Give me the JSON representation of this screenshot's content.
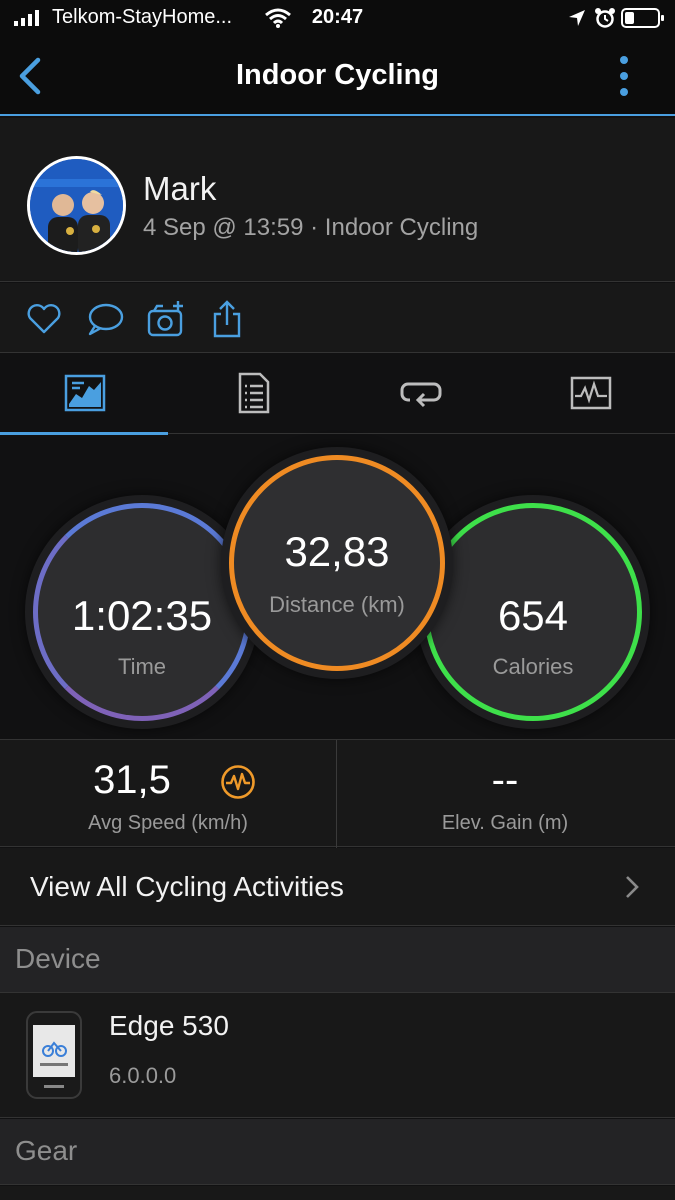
{
  "status_bar": {
    "carrier": "Telkom-StayHome...",
    "time": "20:47",
    "icons": [
      "signal-icon",
      "wifi-icon",
      "location-icon",
      "alarm-icon",
      "battery-icon"
    ]
  },
  "navbar": {
    "title": "Indoor Cycling",
    "back_icon": "chevron-left-icon",
    "more_icon": "more-vertical-icon"
  },
  "profile": {
    "name": "Mark",
    "meta": "4 Sep @ 13:59 · Indoor Cycling"
  },
  "actions": [
    "heart-icon",
    "comment-icon",
    "add-photo-icon",
    "share-icon"
  ],
  "tabs": [
    {
      "icon": "overview-icon",
      "active": true
    },
    {
      "icon": "details-icon",
      "active": false
    },
    {
      "icon": "laps-icon",
      "active": false
    },
    {
      "icon": "charts-icon",
      "active": false
    }
  ],
  "summary": {
    "time": {
      "value": "1:02:35",
      "label": "Time"
    },
    "distance": {
      "value": "32,83",
      "label": "Distance (km)"
    },
    "calories": {
      "value": "654",
      "label": "Calories"
    }
  },
  "stats": {
    "avg_speed": {
      "value": "31,5",
      "label": "Avg Speed (km/h)"
    },
    "elev_gain": {
      "value": "--",
      "label": "Elev. Gain (m)"
    }
  },
  "view_all": {
    "label": "View All Cycling Activities"
  },
  "sections": {
    "device": "Device",
    "gear": "Gear"
  },
  "device": {
    "name": "Edge 530",
    "version": "6.0.0.0"
  },
  "colors": {
    "accent": "#4a9fe0",
    "time_ring": "#5b7ad6",
    "distance_ring": "#ef8b23",
    "calories_ring": "#3ee04a",
    "pulse": "#ef9a2a"
  }
}
